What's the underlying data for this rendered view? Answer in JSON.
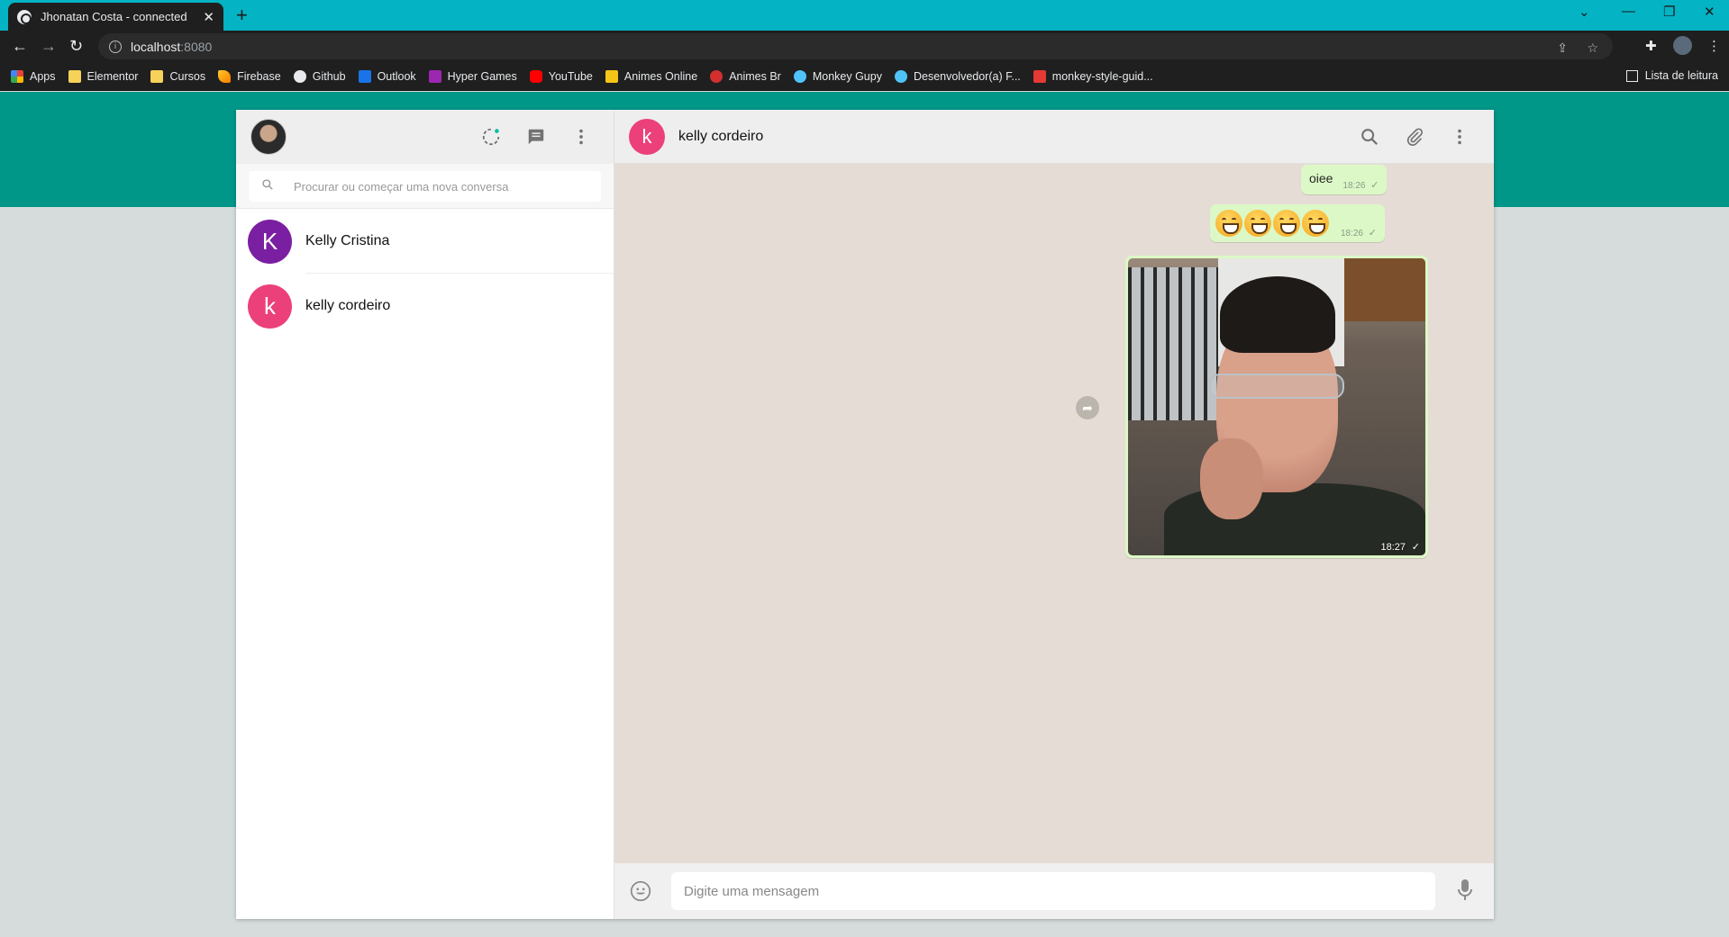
{
  "browser": {
    "tab_title": "Jhonatan Costa - connected",
    "url_host": "localhost",
    "url_port": ":8080",
    "new_tab": "+",
    "bookmarks": [
      {
        "label": "Apps",
        "icon": "apps-grid-icon",
        "color": "#e94335"
      },
      {
        "label": "Elementor",
        "icon": "folder-icon",
        "color": "#f6d25a"
      },
      {
        "label": "Cursos",
        "icon": "folder-icon",
        "color": "#f6d25a"
      },
      {
        "label": "Firebase",
        "icon": "firebase-icon",
        "color": "#f5a623"
      },
      {
        "label": "Github",
        "icon": "github-icon",
        "color": "#e8eaed"
      },
      {
        "label": "Outlook",
        "icon": "outlook-icon",
        "color": "#1a73e8"
      },
      {
        "label": "Hyper Games",
        "icon": "hyper-games-icon",
        "color": "#9c27b0"
      },
      {
        "label": "YouTube",
        "icon": "youtube-icon",
        "color": "#ff0000"
      },
      {
        "label": "Animes Online",
        "icon": "crown-icon",
        "color": "#f5c518"
      },
      {
        "label": "Animes Br",
        "icon": "animes-br-icon",
        "color": "#d32f2f"
      },
      {
        "label": "Monkey Gupy",
        "icon": "monkey-gupy-icon",
        "color": "#4fc3f7"
      },
      {
        "label": "Desenvolvedor(a) F...",
        "icon": "developer-icon",
        "color": "#4fc3f7"
      },
      {
        "label": "monkey-style-guid...",
        "icon": "monkey-style-icon",
        "color": "#e53935"
      }
    ],
    "reading_list": "Lista de leitura"
  },
  "sidebar": {
    "search_placeholder": "Procurar ou começar uma nova conversa",
    "contacts": [
      {
        "initial": "K",
        "name": "Kelly Cristina",
        "color": "#7b1fa2"
      },
      {
        "initial": "k",
        "name": "kelly cordeiro",
        "color": "#ec407a"
      }
    ]
  },
  "chat": {
    "contact_initial": "k",
    "contact_name": "kelly cordeiro",
    "messages": [
      {
        "type": "text",
        "text": "oiee",
        "time": "18:26",
        "status": "✓"
      },
      {
        "type": "emoji",
        "count": 4,
        "time": "18:26",
        "status": "✓"
      },
      {
        "type": "image",
        "time": "18:27",
        "status": "✓"
      }
    ],
    "input_placeholder": "Digite uma mensagem"
  },
  "colors": {
    "teal_header": "#009688",
    "bubble_green": "#dcf8c6",
    "chat_bg": "#e5ddd5"
  }
}
